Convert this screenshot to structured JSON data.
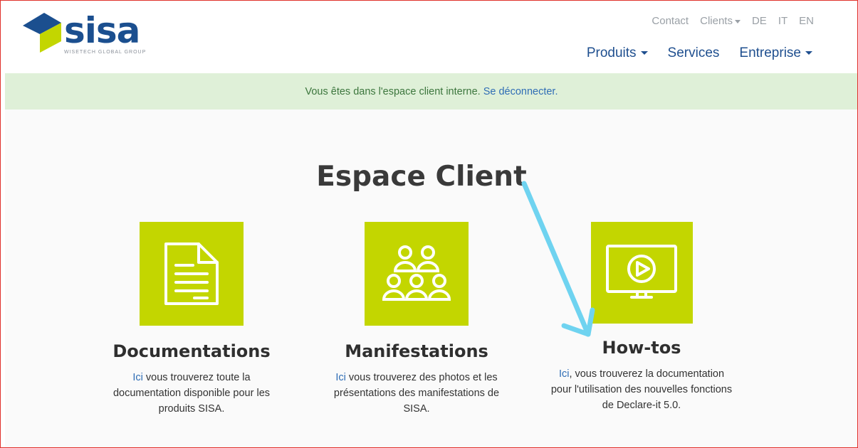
{
  "header": {
    "logo_text": "sisa",
    "logo_sub": "WISETECH GLOBAL GROUP",
    "top_nav": [
      {
        "label": "Contact"
      },
      {
        "label": "Clients",
        "dropdown": true
      },
      {
        "label": "DE"
      },
      {
        "label": "IT"
      },
      {
        "label": "EN"
      }
    ],
    "main_nav": [
      {
        "label": "Produits",
        "dropdown": true
      },
      {
        "label": "Services"
      },
      {
        "label": "Entreprise",
        "dropdown": true
      }
    ]
  },
  "banner": {
    "text": "Vous êtes dans l'espace client interne.",
    "link": "Se déconnecter."
  },
  "page": {
    "title": "Espace Client"
  },
  "cards": [
    {
      "icon": "document-icon",
      "title": "Documentations",
      "link": "Ici",
      "text": " vous trouverez toute la documentation disponible pour les produits SISA."
    },
    {
      "icon": "group-icon",
      "title": "Manifestations",
      "link": "Ici",
      "text": " vous trouverez des photos et les présentations des manifestations de SISA."
    },
    {
      "icon": "video-screen-icon",
      "title": "How-tos",
      "link": "Ici",
      "text": ", vous trouverez la documentation pour l'utilisation des nouvelles fonctions de Declare-it 5.0."
    }
  ],
  "colors": {
    "tile": "#c3d600",
    "brand_blue": "#1b4f8f",
    "link": "#2f6db5",
    "banner_bg": "#dff0d8",
    "annotation_arrow": "#6fd3f0"
  }
}
